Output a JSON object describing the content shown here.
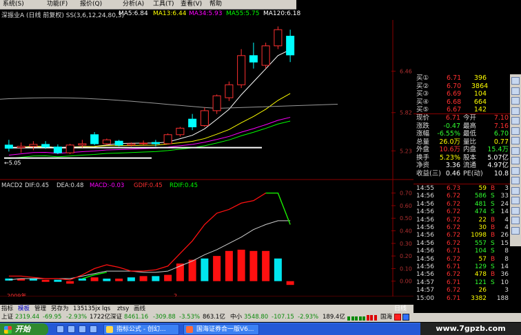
{
  "menu": [
    "系统(S)",
    "功能(F)",
    "报价(Q)",
    "分析(A)",
    "工具(T)",
    "查看(V)",
    "帮助"
  ],
  "main_title": "深振业A (日线 前复权) SS(3,6,12,24,80,3)",
  "ma_labels": [
    {
      "text": "MA5:6.84",
      "color": "#ffffff"
    },
    {
      "text": "MA13:6.44",
      "color": "#ffff00"
    },
    {
      "text": "MA34:5.93",
      "color": "#ff00ff"
    },
    {
      "text": "MA55:5.75",
      "color": "#00ff00"
    },
    {
      "text": "MA120:6.18",
      "color": "#ffffff"
    }
  ],
  "price_axis": [
    "6.46",
    "5.82",
    "5.23"
  ],
  "low_marker": "←5.05",
  "macd_title": {
    "name": "MACD2",
    "dif": "DIF:0.45",
    "dea": "DEA:0.48",
    "macd": "MACD:-0.03",
    "gdif": "GDIF:0.45",
    "rdif": "RDIF:0.45"
  },
  "macd_axis": [
    "0.70",
    "0.60",
    "0.50",
    "0.40",
    "0.30",
    "0.20",
    "0.10",
    "0.00"
  ],
  "chart_data": {
    "type": "candlestick",
    "series": [
      {
        "name": "MACD",
        "values": [
          0.01,
          0.01,
          0.01,
          -0.01,
          -0.01,
          -0.02,
          0.01,
          0.03,
          0.02,
          0.02,
          0.03,
          0.04,
          0.04,
          0.05,
          0.14,
          0.17,
          0.18,
          0.2,
          0.24,
          0.25,
          0.24,
          0.24,
          0.18,
          -0.03
        ]
      },
      {
        "name": "DIF",
        "values": [
          0.04,
          0.04,
          0.03,
          0.02,
          0.02,
          0.01,
          0.05,
          0.1,
          0.13,
          0.11,
          0.08,
          0.08,
          0.09,
          0.12,
          0.22,
          0.32,
          0.45,
          0.54,
          0.57,
          0.62,
          0.64,
          0.7,
          0.7,
          0.45
        ]
      },
      {
        "name": "DEA",
        "values": [
          0.01,
          0.02,
          0.02,
          0.02,
          0.02,
          0.02,
          0.04,
          0.06,
          0.08,
          0.08,
          0.08,
          0.07,
          0.07,
          0.08,
          0.12,
          0.16,
          0.21,
          0.25,
          0.3,
          0.35,
          0.41,
          0.45,
          0.48,
          0.48
        ]
      }
    ],
    "candles": [
      {
        "o": 5.32,
        "h": 5.4,
        "l": 5.22,
        "c": 5.27
      },
      {
        "o": 5.28,
        "h": 5.36,
        "l": 5.2,
        "c": 5.3
      },
      {
        "o": 5.3,
        "h": 5.38,
        "l": 5.24,
        "c": 5.33
      },
      {
        "o": 5.33,
        "h": 5.38,
        "l": 5.26,
        "c": 5.29
      },
      {
        "o": 5.29,
        "h": 5.33,
        "l": 5.18,
        "c": 5.2
      },
      {
        "o": 5.2,
        "h": 5.34,
        "l": 5.18,
        "c": 5.32
      },
      {
        "o": 5.32,
        "h": 5.4,
        "l": 5.28,
        "c": 5.34
      },
      {
        "o": 5.48,
        "h": 5.52,
        "l": 5.32,
        "c": 5.34
      },
      {
        "o": 5.34,
        "h": 5.42,
        "l": 5.32,
        "c": 5.4
      },
      {
        "o": 5.38,
        "h": 5.4,
        "l": 5.3,
        "c": 5.32
      },
      {
        "o": 5.32,
        "h": 5.36,
        "l": 5.3,
        "c": 5.34
      },
      {
        "o": 5.35,
        "h": 5.39,
        "l": 5.32,
        "c": 5.35
      },
      {
        "o": 5.36,
        "h": 5.4,
        "l": 5.3,
        "c": 5.34
      },
      {
        "o": 5.34,
        "h": 5.5,
        "l": 5.33,
        "c": 5.48
      },
      {
        "o": 5.48,
        "h": 5.6,
        "l": 5.45,
        "c": 5.58
      },
      {
        "o": 5.72,
        "h": 5.8,
        "l": 5.55,
        "c": 5.6
      },
      {
        "o": 5.62,
        "h": 5.9,
        "l": 5.6,
        "c": 5.85
      },
      {
        "o": 5.85,
        "h": 6.1,
        "l": 5.8,
        "c": 6.08
      },
      {
        "o": 6.05,
        "h": 6.3,
        "l": 6.0,
        "c": 6.25
      },
      {
        "o": 6.25,
        "h": 6.8,
        "l": 6.2,
        "c": 6.7
      },
      {
        "o": 6.7,
        "h": 6.9,
        "l": 6.5,
        "c": 6.6
      },
      {
        "o": 6.55,
        "h": 6.9,
        "l": 6.5,
        "c": 6.85
      },
      {
        "o": 6.85,
        "h": 7.15,
        "l": 6.8,
        "c": 7.1
      },
      {
        "o": 7.0,
        "h": 7.1,
        "l": 6.6,
        "c": 6.71
      }
    ]
  },
  "quote": {
    "bids": [
      {
        "label": "买①",
        "price": "6.71",
        "vol": "396"
      },
      {
        "label": "买②",
        "price": "6.70",
        "vol": "3864"
      },
      {
        "label": "买③",
        "price": "6.69",
        "vol": "104"
      },
      {
        "label": "买④",
        "price": "6.68",
        "vol": "664"
      },
      {
        "label": "买⑤",
        "price": "6.67",
        "vol": "142"
      }
    ],
    "stats": [
      {
        "l1": "现价",
        "v1": "6.71",
        "l2": "今开",
        "v2": "7.10",
        "c1": "#ff3030",
        "c2": "#ff3030"
      },
      {
        "l1": "涨跌",
        "v1": "-0.47",
        "l2": "最高",
        "v2": "7.16",
        "c1": "#30ff30",
        "c2": "#ff3030"
      },
      {
        "l1": "涨幅",
        "v1": "-6.55%",
        "l2": "最低",
        "v2": "6.70",
        "c1": "#30ff30",
        "c2": "#30ff30"
      },
      {
        "l1": "总量",
        "v1": "26.0万",
        "l2": "量比",
        "v2": "0.77",
        "c1": "#ffff00",
        "c2": "#ffff00"
      },
      {
        "l1": "外盘",
        "v1": "10.6万",
        "l2": "内盘",
        "v2": "15.4万",
        "c1": "#ff3030",
        "c2": "#30ff30"
      },
      {
        "l1": "换手",
        "v1": "5.23%",
        "l2": "股本",
        "v2": "5.07亿",
        "c1": "#ffff00",
        "c2": "#ffffff"
      },
      {
        "l1": "净资",
        "v1": "3.36",
        "l2": "流通",
        "v2": "4.97亿",
        "c1": "#ffffff",
        "c2": "#ffffff"
      },
      {
        "l1": "收益(三)",
        "v1": "0.46",
        "l2": "PE(动)",
        "v2": "10.8",
        "c1": "#ffffff",
        "c2": "#ffffff"
      }
    ],
    "ticks": [
      {
        "time": "14:55",
        "price": "6.73",
        "vol": "59",
        "dir": "B",
        "n": "3"
      },
      {
        "time": "14:56",
        "price": "6.72",
        "vol": "586",
        "dir": "S",
        "n": "33"
      },
      {
        "time": "14:56",
        "price": "6.72",
        "vol": "481",
        "dir": "S",
        "n": "24"
      },
      {
        "time": "14:56",
        "price": "6.72",
        "vol": "474",
        "dir": "S",
        "n": "14"
      },
      {
        "time": "14:56",
        "price": "6.72",
        "vol": "22",
        "dir": "B",
        "n": "4"
      },
      {
        "time": "14:56",
        "price": "6.72",
        "vol": "30",
        "dir": "B",
        "n": "4"
      },
      {
        "time": "14:56",
        "price": "6.72",
        "vol": "1098",
        "dir": "B",
        "n": "26"
      },
      {
        "time": "14:56",
        "price": "6.72",
        "vol": "557",
        "dir": "S",
        "n": "15"
      },
      {
        "time": "14:56",
        "price": "6.71",
        "vol": "104",
        "dir": "S",
        "n": "8"
      },
      {
        "time": "14:56",
        "price": "6.72",
        "vol": "57",
        "dir": "B",
        "n": "8"
      },
      {
        "time": "14:56",
        "price": "6.71",
        "vol": "129",
        "dir": "S",
        "n": "14"
      },
      {
        "time": "14:56",
        "price": "6.72",
        "vol": "478",
        "dir": "B",
        "n": "36"
      },
      {
        "time": "14:57",
        "price": "6.71",
        "vol": "121",
        "dir": "S",
        "n": "10"
      },
      {
        "time": "14:57",
        "price": "6.72",
        "vol": "26",
        "dir": "",
        "n": "3"
      },
      {
        "time": "15:00",
        "price": "6.71",
        "vol": "3382",
        "dir": "",
        "n": "188"
      }
    ]
  },
  "year_label": "2009年",
  "month_label": "2",
  "tabs": [
    "指标",
    "模板",
    "管理",
    "另存为",
    "135",
    "135jx",
    "lqs",
    "ztsy",
    "画线"
  ],
  "right_tab": "日线",
  "status": {
    "sh_label": "上证",
    "sh_val": "2319.44",
    "sh_chg": "-69.95",
    "sh_pct": "-2.93%",
    "sh_amt": "1722亿",
    "sz_label": "深证",
    "sz_val": "8461.16",
    "sz_chg": "-309.88",
    "sz_pct": "-3.53%",
    "sz_amt": "863.1亿",
    "zx_label": "中小",
    "zx_val": "3548.80",
    "zx_chg": "-107.15",
    "zx_pct": "-2.93%",
    "zx_amt": "189.4亿",
    "brand": "国海"
  },
  "taskbar": {
    "start": "开始",
    "t1": "指标公式 - 创幻...",
    "t2": "国海证券合一版V6..."
  },
  "watermark": "www.7gpzb.com",
  "colors": {
    "up": "#ff3030",
    "down": "#00ffff",
    "bg": "#000000"
  }
}
